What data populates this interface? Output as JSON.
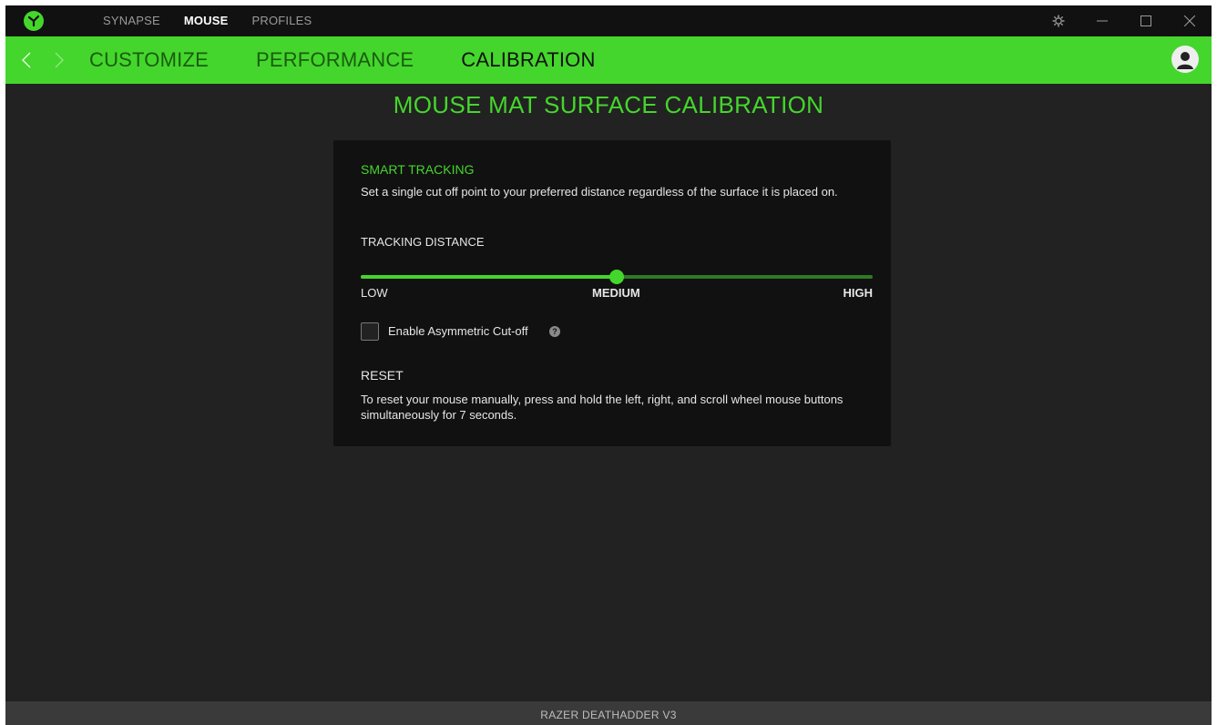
{
  "titlebar": {
    "nav": [
      "SYNAPSE",
      "MOUSE",
      "PROFILES"
    ],
    "active_nav": "MOUSE"
  },
  "subnav": {
    "tabs": [
      "CUSTOMIZE",
      "PERFORMANCE",
      "CALIBRATION"
    ],
    "active_tab": "CALIBRATION"
  },
  "page": {
    "title": "MOUSE MAT SURFACE CALIBRATION"
  },
  "smart_tracking": {
    "heading": "SMART TRACKING",
    "description": "Set a single cut off point to your preferred distance regardless of the surface it is placed on.",
    "distance_label": "TRACKING DISTANCE",
    "slider": {
      "low": "LOW",
      "medium": "MEDIUM",
      "high": "HIGH",
      "value": 0.5
    },
    "asymmetric_label": "Enable Asymmetric Cut-off",
    "asymmetric_checked": false
  },
  "reset": {
    "heading": "RESET",
    "description": "To reset your mouse manually, press and hold the left, right, and scroll wheel mouse buttons simultaneously for 7 seconds."
  },
  "status": {
    "device": "RAZER DEATHADDER V3"
  },
  "colors": {
    "accent": "#44d62c",
    "background": "#222222",
    "panel": "#111111"
  }
}
